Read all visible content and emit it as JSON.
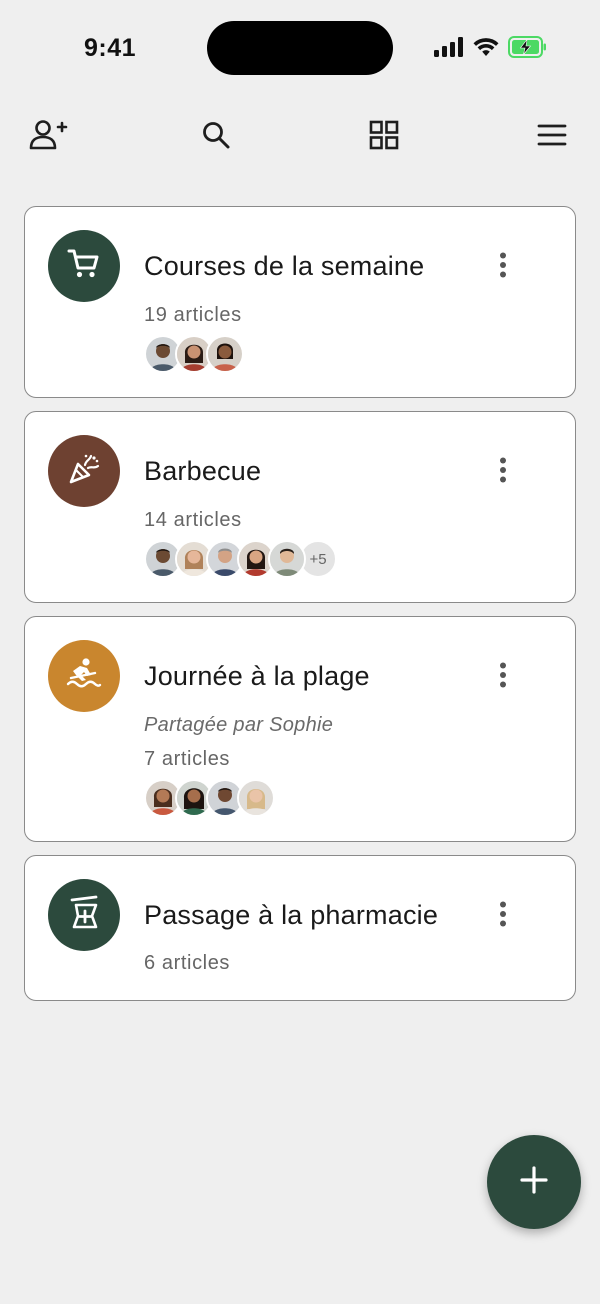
{
  "status_bar": {
    "time": "9:41",
    "icons": [
      "signal-icon",
      "wifi-icon",
      "battery-charging-icon"
    ],
    "battery_color": "#4cd964"
  },
  "toolbar": {
    "icons": [
      "add-user-icon",
      "search-icon",
      "grid-view-icon",
      "menu-icon"
    ]
  },
  "colors": {
    "background": "#efefef",
    "accent": "#2c4a3d",
    "card_border": "#8a8a8a"
  },
  "lists": [
    {
      "title": "Courses de la semaine",
      "icon": "shopping-cart-icon",
      "icon_bg": "#2c4a3d",
      "shared_by": "",
      "count": "19 articles",
      "avatar_count": 3,
      "extra_members": ""
    },
    {
      "title": "Barbecue",
      "icon": "party-popper-icon",
      "icon_bg": "#6e4131",
      "shared_by": "",
      "count": "14 articles",
      "avatar_count": 5,
      "extra_members": "+5"
    },
    {
      "title": "Journée à la plage",
      "icon": "surfing-icon",
      "icon_bg": "#c9862e",
      "shared_by": "Partagée par Sophie",
      "count": "7 articles",
      "avatar_count": 4,
      "extra_members": ""
    },
    {
      "title": "Passage à la pharmacie",
      "icon": "pharmacy-icon",
      "icon_bg": "#2c4a3d",
      "shared_by": "",
      "count": "6 articles",
      "avatar_count": 0,
      "extra_members": ""
    }
  ],
  "fab": {
    "icon": "plus-icon"
  }
}
